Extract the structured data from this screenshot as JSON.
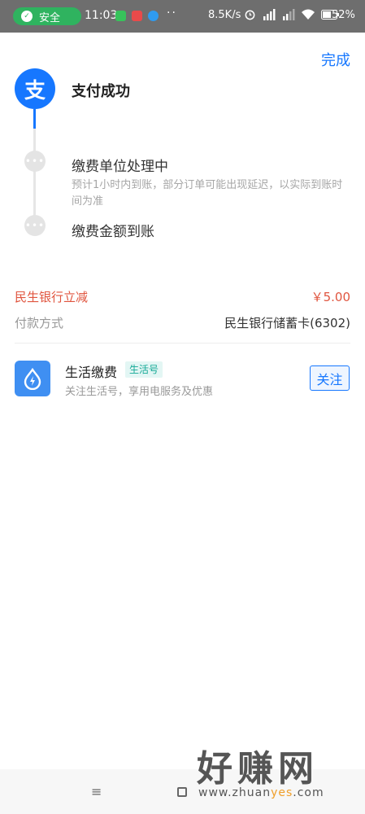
{
  "status_bar": {
    "safe_label": "安全",
    "time": "11:03",
    "dots": "··",
    "net_speed": "8.5K/s",
    "battery": "52%"
  },
  "header": {
    "done_label": "完成"
  },
  "result": {
    "logo_char": "支",
    "title": "支付成功"
  },
  "steps": [
    {
      "title": "缴费单位处理中",
      "desc": "预计1小时内到账，部分订单可能出现延迟，以实际到账时间为准",
      "icon": "ellipsis-icon"
    },
    {
      "title": "缴费金额到账",
      "icon": "ellipsis-icon"
    }
  ],
  "details": {
    "discount_label": "民生银行立减",
    "discount_value": "￥5.00",
    "payment_label": "付款方式",
    "payment_value": "民生银行储蓄卡(6302)"
  },
  "service": {
    "name": "生活缴费",
    "badge": "生活号",
    "desc": "关注生活号，享用电服务及优惠",
    "follow_label": "关注",
    "icon": "water-drop-bolt-icon"
  },
  "nav": {
    "menu_glyph": "≡"
  },
  "watermark": {
    "big_text": "好赚网",
    "url_pre": "www.zhuan",
    "url_hl": "yes",
    "url_post": ".com"
  },
  "colors": {
    "accent": "#1677ff",
    "discount": "#e0553f",
    "status_pill": "#2fb35f",
    "badge_text": "#15a996"
  }
}
